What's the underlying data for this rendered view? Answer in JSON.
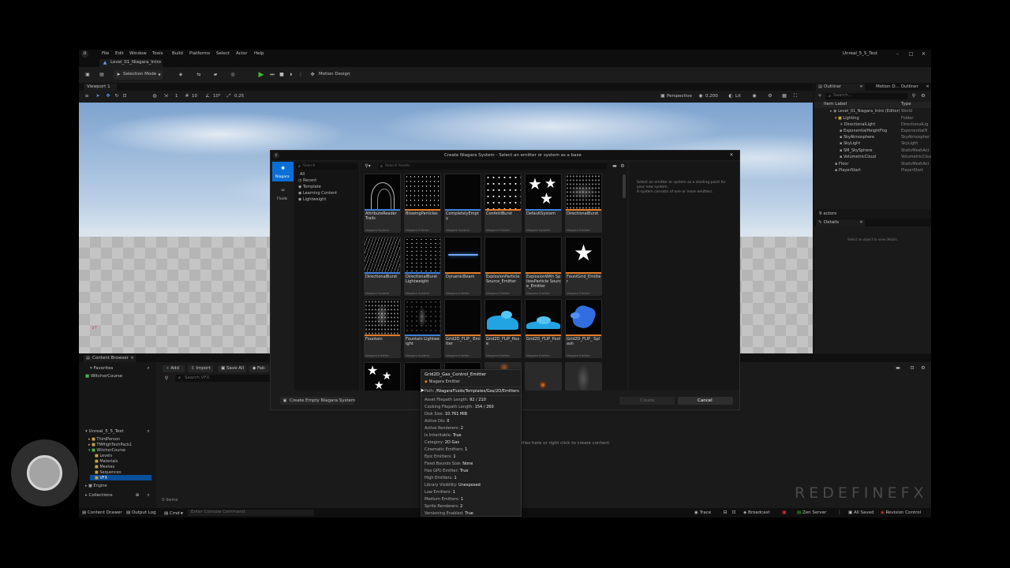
{
  "menu": {
    "items": [
      "File",
      "Edit",
      "Window",
      "Tools",
      "Build",
      "Platforms",
      "Select",
      "Actor",
      "Help"
    ],
    "project_title": "Unreal_5_5_Test",
    "level_tab": "Level_01_Niagara_Intro"
  },
  "toolbar": {
    "selection_mode": "Selection Mode",
    "motion_design": "Motion Design"
  },
  "viewport": {
    "tab": "Viewport 1",
    "perspective": "Perspective",
    "lit": "Lit",
    "grid_snap": "10",
    "rot_snap": "10°",
    "scale_snap": "0.25",
    "cam_speed": "0.200",
    "snap_num": "1"
  },
  "outliner": {
    "tab": "Outliner",
    "tab2": "Motion D... Outliner",
    "search_placeholder": "Search...",
    "col_label": "Item Label",
    "col_type": "Type",
    "rows": [
      {
        "label": "Level_01_Niagara_Intro (Editor)",
        "type": "World"
      },
      {
        "label": "Lighting",
        "type": "Folder"
      },
      {
        "label": "DirectionalLight",
        "type": "DirectionalLig"
      },
      {
        "label": "ExponentialHeightFog",
        "type": "ExponentialH"
      },
      {
        "label": "SkyAtmosphere",
        "type": "SkyAtmospher"
      },
      {
        "label": "SkyLight",
        "type": "SkyLight"
      },
      {
        "label": "SM_SkySphere",
        "type": "StaticMeshAct"
      },
      {
        "label": "VolumetricCloud",
        "type": "VolumetricClou"
      },
      {
        "label": "Floor",
        "type": "StaticMeshAct"
      },
      {
        "label": "PlayerStart",
        "type": "PlayerStart"
      }
    ],
    "actor_count": "9 actors"
  },
  "details": {
    "tab": "Details",
    "empty": "Select an object to view details."
  },
  "dialog": {
    "title": "Create Niagara System - Select an emitter or system as a base",
    "sidebar": [
      {
        "label": "Niagara"
      },
      {
        "label": "Fluids"
      }
    ],
    "tree_search": "Search",
    "tree": [
      "All",
      "Recent",
      "Template",
      "Learning Content",
      "Lightweight"
    ],
    "asset_search": "Search Assets",
    "info": "Select an emitter or system as a starting point for your new system.\nA system consists of one or more emitters.",
    "create_empty": "Create Empty Niagara System",
    "create": "Create",
    "cancel": "Cancel"
  },
  "assets": [
    {
      "name": "AttributeReader Trails",
      "type": "Niagara System"
    },
    {
      "name": "BlowingParticles",
      "type": "Niagara Emitter"
    },
    {
      "name": "CompletelyEmpty",
      "type": "Niagara System"
    },
    {
      "name": "ConfettiBurst",
      "type": "Niagara Emitter"
    },
    {
      "name": "DefaultSystem",
      "type": "Niagara System"
    },
    {
      "name": "DirectionalBurst",
      "type": "Niagara Emitter"
    },
    {
      "name": "DirectionalBurst",
      "type": "Niagara System"
    },
    {
      "name": "DirectionalBurst Lightweight",
      "type": "Niagara System"
    },
    {
      "name": "DynamicBeam",
      "type": "Niagara Emitter"
    },
    {
      "name": "ExplosionParticle Source_Emitter",
      "type": "Niagara Emitter"
    },
    {
      "name": "ExplosionWith SpikesParticle Source_Emitter",
      "type": "Niagara Emitter"
    },
    {
      "name": "FountGrid_Emitter",
      "type": "Niagara Emitter"
    },
    {
      "name": "Fountain",
      "type": "Niagara Emitter"
    },
    {
      "name": "Fountain Lightweight",
      "type": "Niagara System"
    },
    {
      "name": "Grid2D_FLIP_ Emitter",
      "type": "Niagara Emitter"
    },
    {
      "name": "Grid2D_FLIP_Hose",
      "type": "Niagara Emitter"
    },
    {
      "name": "Grid2D_FLIP_Pool",
      "type": "Niagara Emitter"
    },
    {
      "name": "Grid2D_FLIP_ Splash",
      "type": "Niagara Emitter"
    }
  ],
  "tooltip": {
    "title": "Grid2D_Gas_Control_Emitter",
    "subtitle": "Niagara Emitter",
    "path_label": "Path:",
    "path": "/NiagaraFluids/Templates/Gas/2D/Emitters",
    "rows": [
      {
        "k": "Asset Filepath Length:",
        "v": "92 / 210"
      },
      {
        "k": "Cooking Filepath Length:",
        "v": "154 / 260"
      },
      {
        "k": "Disk Size:",
        "v": "10.761 MiB"
      },
      {
        "k": "Active Dis:",
        "v": "0"
      },
      {
        "k": "Active Renderers:",
        "v": "2"
      },
      {
        "k": "Is Inheritable:",
        "v": "True"
      },
      {
        "k": "Category:",
        "v": "2D Gas"
      },
      {
        "k": "Cinematic Emitters:",
        "v": "1"
      },
      {
        "k": "Epic Emitters:",
        "v": "1"
      },
      {
        "k": "Fixed Bounds Size:",
        "v": "None"
      },
      {
        "k": "Has GPU Emitter:",
        "v": "True"
      },
      {
        "k": "High Emitters:",
        "v": "1"
      },
      {
        "k": "Library Visibility:",
        "v": "Unexposed"
      },
      {
        "k": "Low Emitters:",
        "v": "1"
      },
      {
        "k": "Medium Emitters:",
        "v": "1"
      },
      {
        "k": "Sprite Renderers:",
        "v": "2"
      },
      {
        "k": "Versioning Enabled:",
        "v": "True"
      }
    ]
  },
  "content_browser": {
    "tab": "Content Browser",
    "favorites": "Favorites",
    "favorite_item": "WitcherCourse",
    "add": "Add",
    "import": "Import",
    "save_all": "Save All",
    "fab": "Fab",
    "search_placeholder": "Search VFX",
    "project": "Unreal_5_5_Test",
    "tree": [
      "ThirdPerson",
      "TMHighTechPack1",
      "WitcherCourse",
      "Levels",
      "Materials",
      "Meshes",
      "Sequences",
      "VFX",
      "Engine"
    ],
    "collections": "Collections",
    "items_count": "0 items",
    "empty_hint": "Drop files here or right click to create content."
  },
  "status": {
    "content_drawer": "Content Drawer",
    "output_log": "Output Log",
    "cmd": "Cmd",
    "console_placeholder": "Enter Console Command",
    "trace": "Trace",
    "broadcast": "Broadcast",
    "zen_server": "Zen Server",
    "all_saved": "All Saved",
    "revision_control": "Revision Control"
  },
  "watermark": "REDEFINEFX",
  "colors": {
    "accent_blue": "#0a6fd6",
    "play_green": "#3cbb3c",
    "fountain_blue": "#2aa7e6"
  }
}
